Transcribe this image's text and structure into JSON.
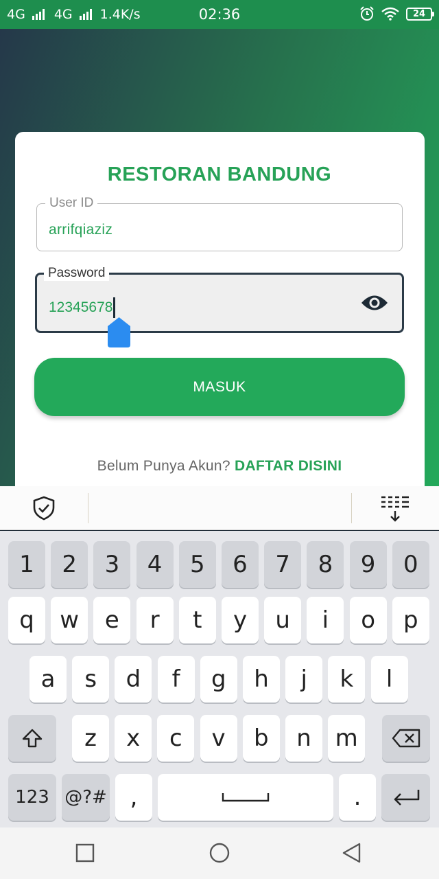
{
  "status_bar": {
    "net1": "4G",
    "net2": "4G",
    "speed": "1.4K/s",
    "time": "02:36",
    "battery": "24",
    "icons": [
      "signal-icon",
      "alarm-icon",
      "wifi-icon",
      "battery-icon"
    ]
  },
  "login": {
    "title": "RESTORAN BANDUNG",
    "user_label": "User ID",
    "user_value": "arrifqiaziz",
    "password_label": "Password",
    "password_value": "12345678",
    "submit_label": "MASUK",
    "signup_prompt": "Belum Punya Akun?",
    "signup_link": "DAFTAR DISINI"
  },
  "keyboard": {
    "row_numbers": [
      "1",
      "2",
      "3",
      "4",
      "5",
      "6",
      "7",
      "8",
      "9",
      "0"
    ],
    "row_top": [
      "q",
      "w",
      "e",
      "r",
      "t",
      "y",
      "u",
      "i",
      "o",
      "p"
    ],
    "row_mid": [
      "a",
      "s",
      "d",
      "f",
      "g",
      "h",
      "j",
      "k",
      "l"
    ],
    "row_bottom": [
      "z",
      "x",
      "c",
      "v",
      "b",
      "n",
      "m"
    ],
    "numbers_key": "123",
    "symbols_key": "@?#",
    "comma_key": ",",
    "period_key": "."
  },
  "colors": {
    "brand_green": "#27a257",
    "button_green": "#23a95a",
    "status_bar": "#1e8e4e"
  }
}
